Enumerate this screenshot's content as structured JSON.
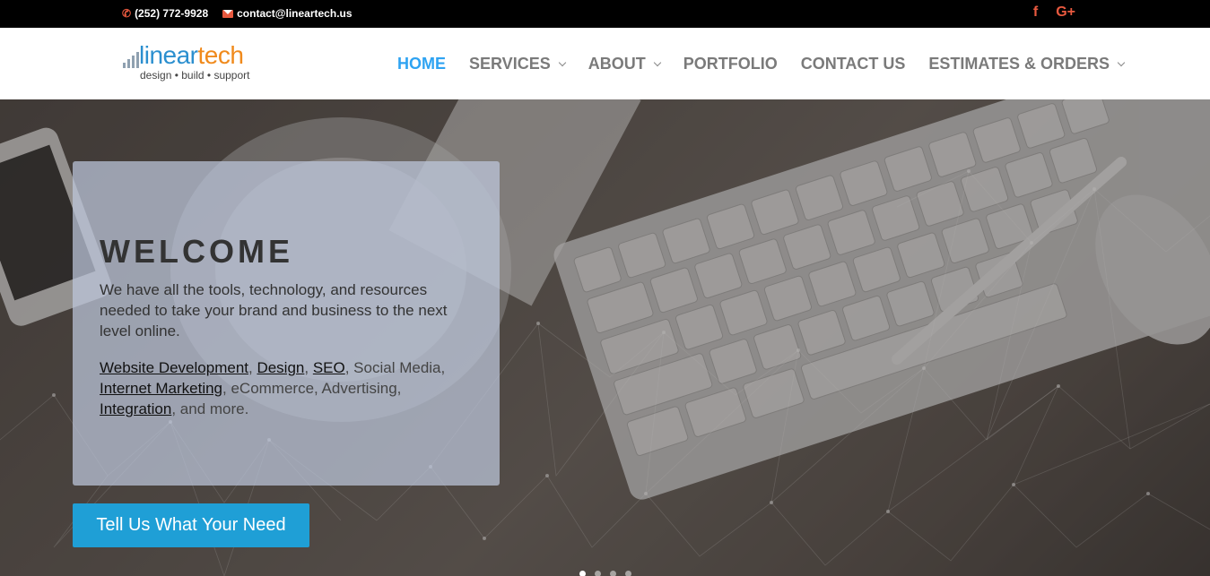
{
  "topbar": {
    "phone": "(252) 772-9928",
    "email": "contact@lineartech.us",
    "phone_icon": "phone-icon",
    "email_icon": "mail-icon",
    "social": [
      {
        "name": "facebook-icon",
        "glyph": "f"
      },
      {
        "name": "google-plus-icon",
        "glyph": "G+"
      }
    ],
    "accent": "#e8593f"
  },
  "logo": {
    "part1": "linear",
    "part2": "tech",
    "tagline": "design • build • support"
  },
  "nav": {
    "items": [
      {
        "label": "HOME",
        "active": true,
        "dropdown": false
      },
      {
        "label": "SERVICES",
        "active": false,
        "dropdown": true
      },
      {
        "label": "ABOUT",
        "active": false,
        "dropdown": true
      },
      {
        "label": "PORTFOLIO",
        "active": false,
        "dropdown": false
      },
      {
        "label": "CONTACT US",
        "active": false,
        "dropdown": false
      },
      {
        "label": "ESTIMATES & ORDERS",
        "active": false,
        "dropdown": true
      }
    ],
    "active_color": "#2ea3f2"
  },
  "hero": {
    "title": "WELCOME",
    "text": "We have all the tools, technology, and resources needed to take your brand and business to the next level online.",
    "links": [
      "Website Development",
      "Design",
      "SEO",
      "Internet Marketing",
      "Integration"
    ],
    "plain": {
      "sep1": ", ",
      "sep2": ", ",
      "after_seo": ", Social Media, ",
      "after_im": ", eCommerce, Advertising, ",
      "after_int": ", and more."
    },
    "cta": "Tell Us What Your Need",
    "cta_color": "#1f9fd6",
    "slides": 4,
    "active_slide": 1
  }
}
